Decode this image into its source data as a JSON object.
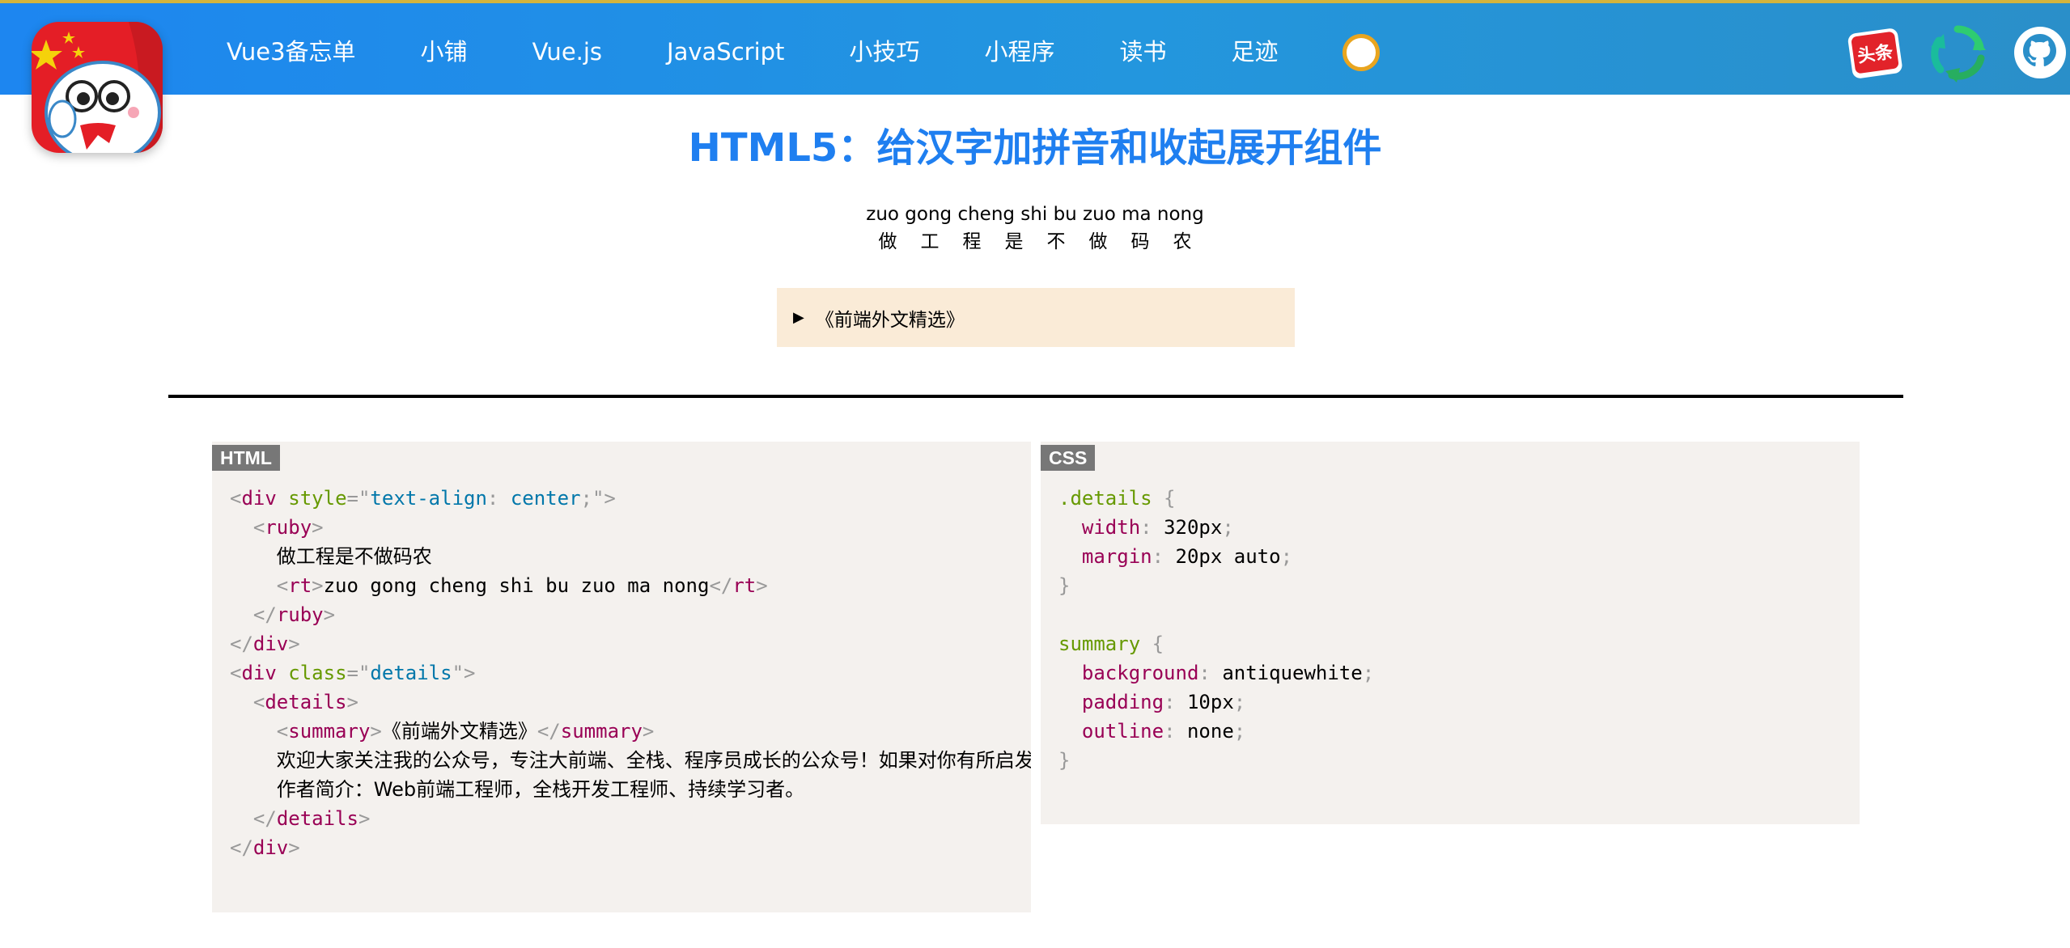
{
  "nav": {
    "items": [
      "Vue3备忘单",
      "小铺",
      "Vue.js",
      "JavaScript",
      "小技巧",
      "小程序",
      "读书",
      "足迹"
    ]
  },
  "header_icons": [
    "toutiao-icon",
    "refresh-icon",
    "github-icon"
  ],
  "header_icon_texts": {
    "toutiao": "头条"
  },
  "colors": {
    "header_blue": "#1d86f0",
    "title_blue": "#1f7ff0",
    "summary_bg": "#faebd7",
    "code_bg": "#f4f1ee"
  },
  "main": {
    "title": "HTML5：给汉字加拼音和收起展开组件",
    "ruby_rt": "zuo gong cheng shi bu zuo ma nong",
    "ruby_base": "做工程是不做码农",
    "details_marker": "▶",
    "details_summary": "《前端外文精选》"
  },
  "html_panel": {
    "label": "HTML",
    "l1_tag": "div",
    "l1_attr": "style",
    "l1_val_prop": "text-align",
    "l1_val_v": "center",
    "l2_tag": "ruby",
    "l3_text": "做工程是不做码农",
    "l4_tag": "rt",
    "l4_text": "zuo gong cheng shi bu zuo ma nong",
    "l5_tag": "ruby",
    "l6_tag": "div",
    "l7_tag": "div",
    "l7_attr": "class",
    "l7_val": "details",
    "l8_tag": "details",
    "l9_tag": "summary",
    "l9_text": "《前端外文精选》",
    "l10_text": "欢迎大家关注我的公众号，专注大前端、全栈、程序员成长的公众号！如果对你有所启发",
    "l11_text": "作者简介：Web前端工程师，全栈开发工程师、持续学习者。",
    "l12_tag": "details",
    "l13_tag": "div"
  },
  "css_panel": {
    "label": "CSS",
    "sel1": ".details",
    "p1": "width",
    "v1": "320px",
    "p2": "margin",
    "v2": "20px auto",
    "sel2": "summary",
    "p3": "background",
    "v3": "antiquewhite",
    "p4": "padding",
    "v4": "10px",
    "p5": "outline",
    "v5": "none"
  }
}
